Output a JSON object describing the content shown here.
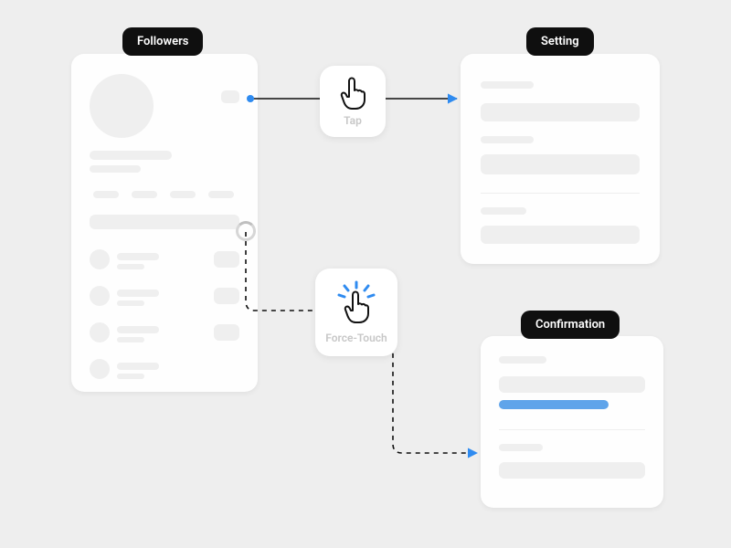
{
  "badges": {
    "followers": "Followers",
    "setting": "Setting",
    "confirmation": "Confirmation"
  },
  "gestures": {
    "tap": "Tap",
    "force_touch": "Force-Touch"
  },
  "colors": {
    "accent": "#2f8bf0",
    "ink": "#0f0f0f",
    "placeholder": "#efefef",
    "bg": "#eeeeee"
  },
  "diagram": {
    "nodes": [
      "Followers",
      "Setting",
      "Confirmation"
    ],
    "edges": [
      {
        "from": "Followers",
        "to": "Setting",
        "gesture": "Tap",
        "style": "solid"
      },
      {
        "from": "Followers",
        "to": "Confirmation",
        "gesture": "Force-Touch",
        "style": "dashed"
      }
    ]
  }
}
